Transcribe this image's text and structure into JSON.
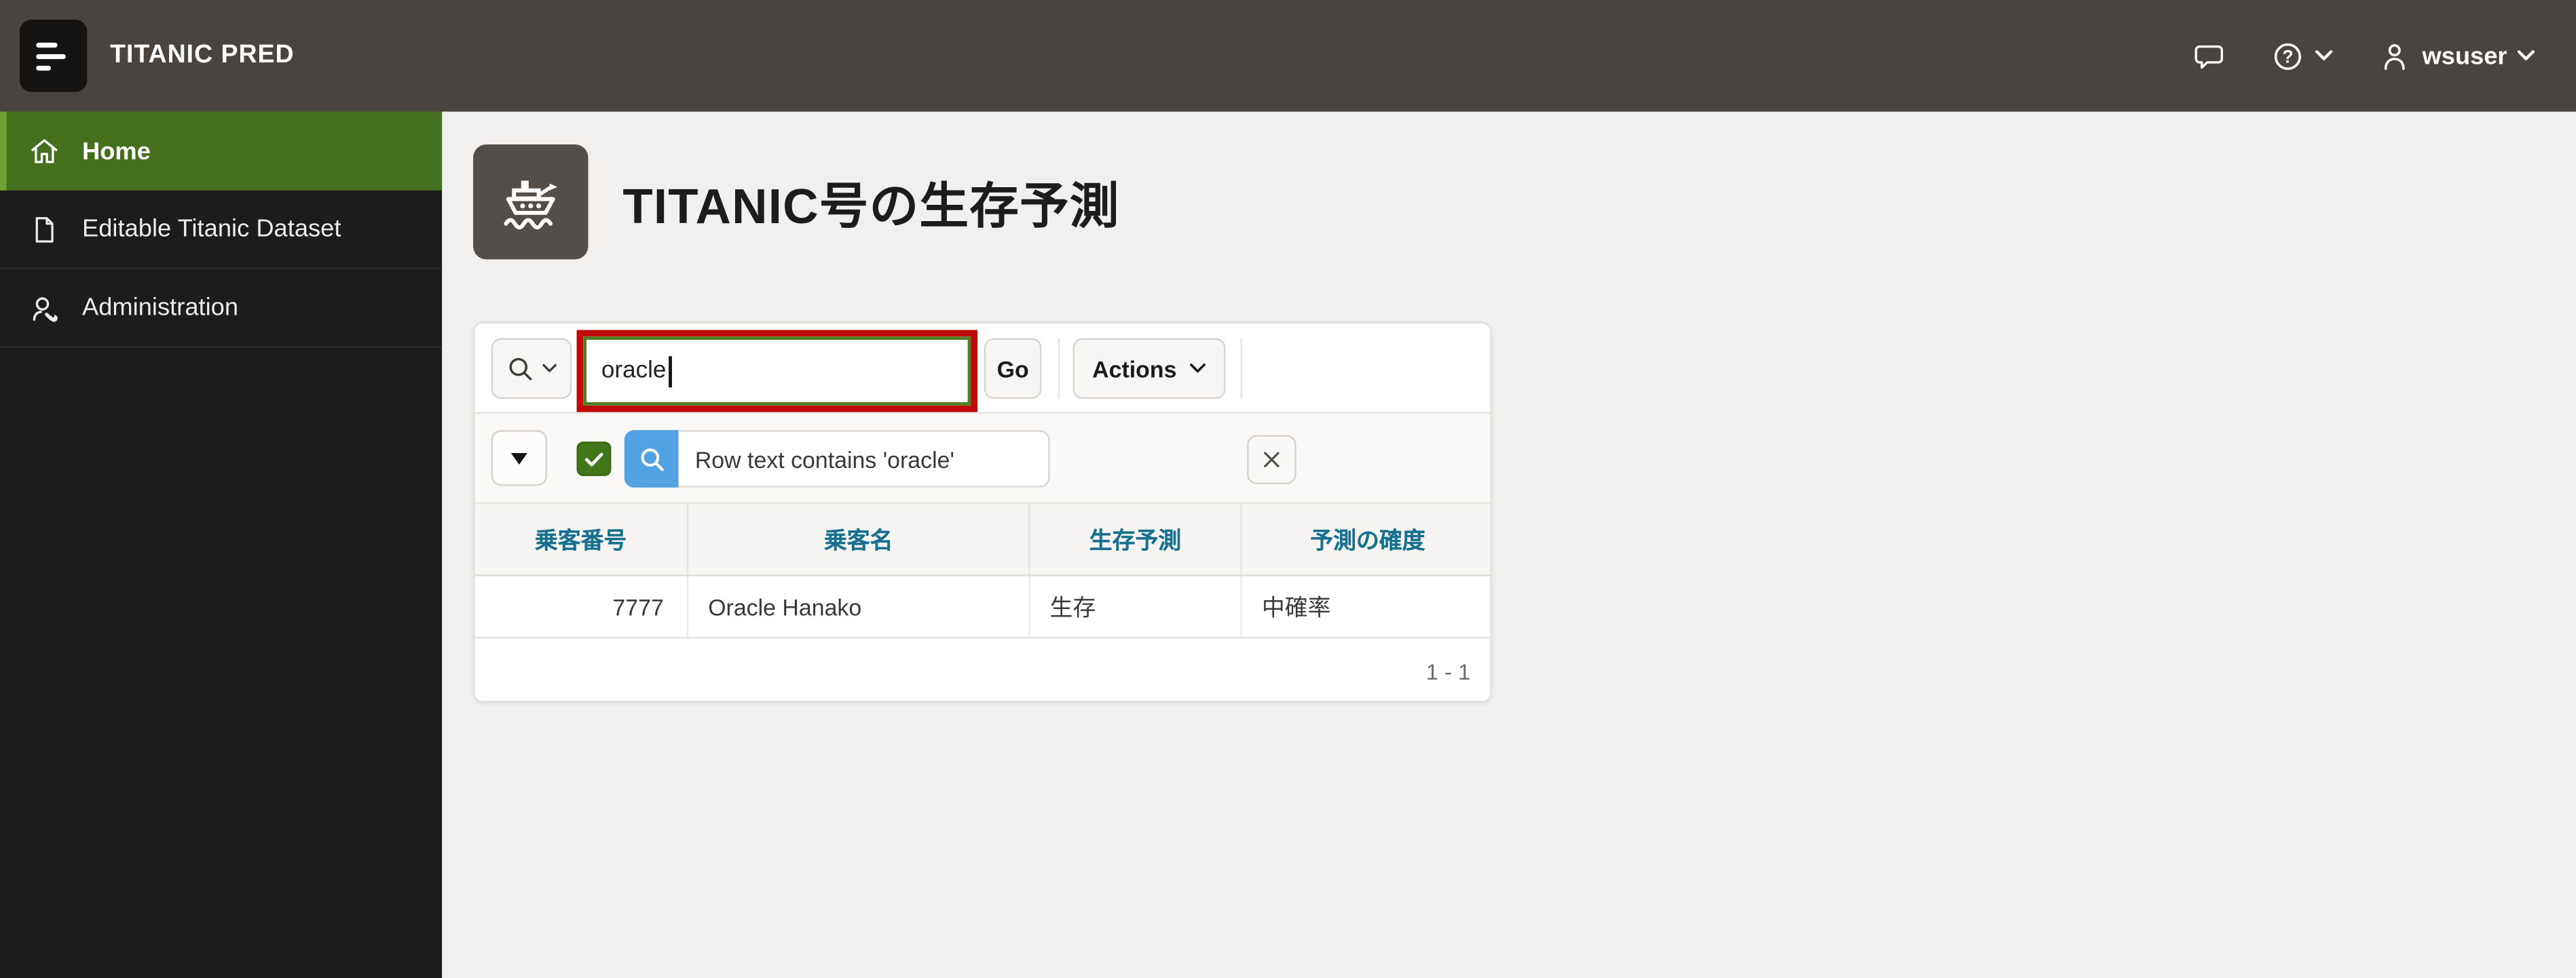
{
  "app": {
    "title": "TITANIC PRED"
  },
  "header": {
    "user_label": "wsuser",
    "icons": [
      "menu-icon",
      "chat-icon",
      "help-icon",
      "chevron-down-icon",
      "user-icon"
    ]
  },
  "sidebar": {
    "items": [
      {
        "label": "Home",
        "icon": "home-icon",
        "active": true
      },
      {
        "label": "Editable Titanic Dataset",
        "icon": "document-icon",
        "active": false
      },
      {
        "label": "Administration",
        "icon": "admin-user-wrench-icon",
        "active": false
      }
    ]
  },
  "page": {
    "title": "TITANIC号の生存予測",
    "icon": "ship-icon"
  },
  "toolbar": {
    "search_value": "oracle",
    "go_label": "Go",
    "actions_label": "Actions",
    "search_icon": "magnifier-icon"
  },
  "filter": {
    "enabled": true,
    "text": "Row text contains 'oracle'",
    "icons": [
      "triangle-down-icon",
      "checkbox-check-icon",
      "magnifier-icon",
      "close-icon"
    ]
  },
  "table": {
    "columns": [
      "乗客番号",
      "乗客名",
      "生存予測",
      "予測の確度"
    ],
    "rows": [
      [
        "7777",
        "Oracle Hanako",
        "生存",
        "中確率"
      ]
    ]
  },
  "pagination": {
    "label": "1 - 1"
  },
  "colors": {
    "header_bg": "#4a4440",
    "sidebar_bg": "#1c1c1c",
    "nav_active_green": "#446f1d",
    "nav_active_stripe": "#6da233",
    "page_bg": "#f1f0ee",
    "accent_blue": "#53a2e4",
    "checkbox_green": "#42761a",
    "focus_green": "#507f21",
    "highlight_red": "#bf0808",
    "column_link_teal": "#17708e"
  }
}
